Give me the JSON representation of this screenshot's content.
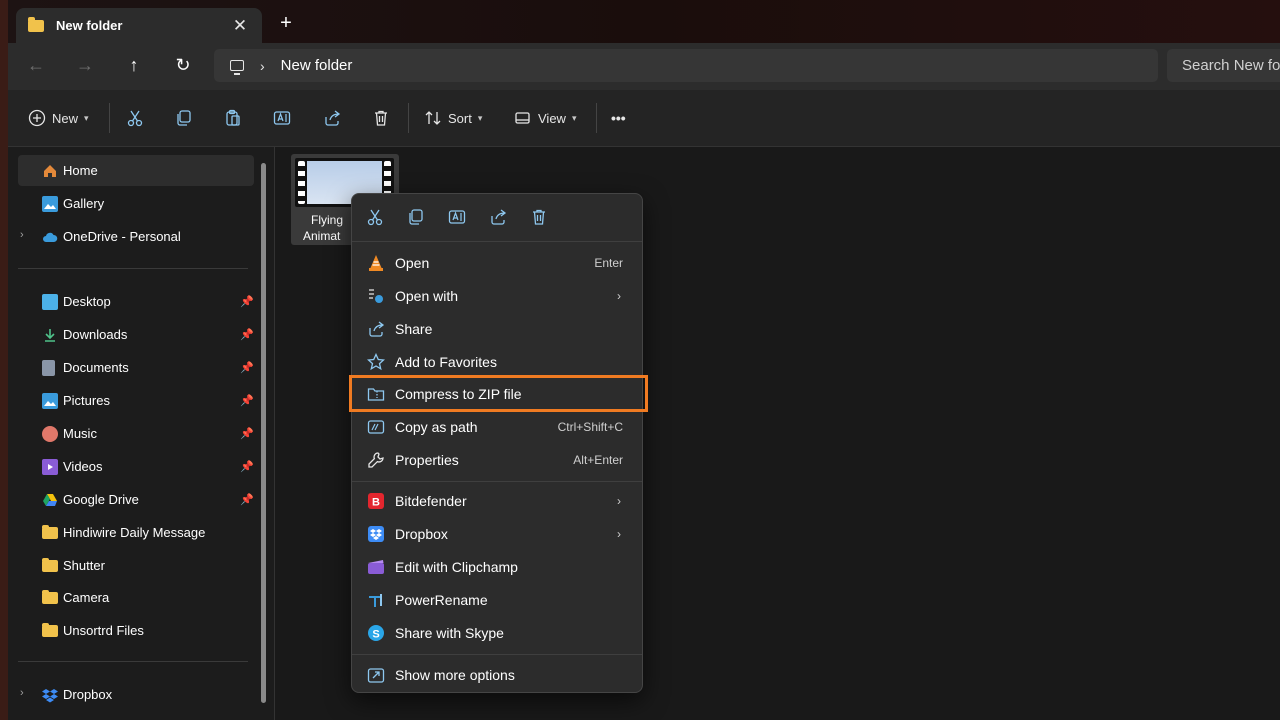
{
  "window": {
    "tab_title": "New folder",
    "tab_close": "✕",
    "new_tab": "+"
  },
  "nav": {
    "back": "←",
    "forward": "→",
    "up": "↑",
    "refresh": "↻",
    "breadcrumb_sep": "›",
    "breadcrumb": "New folder",
    "search_placeholder": "Search New folder"
  },
  "toolbar": {
    "new_label": "New",
    "sort_label": "Sort",
    "view_label": "View",
    "more_label": "•••"
  },
  "sidebar": {
    "home": "Home",
    "gallery": "Gallery",
    "onedrive": "OneDrive - Personal",
    "desktop": "Desktop",
    "downloads": "Downloads",
    "documents": "Documents",
    "pictures": "Pictures",
    "music": "Music",
    "videos": "Videos",
    "google_drive": "Google Drive",
    "hindiwire": "Hindiwire Daily Message",
    "shutter": "Shutter",
    "camera": "Camera",
    "unsortrd": "Unsortrd Files",
    "dropbox": "Dropbox"
  },
  "file": {
    "name_line1": "Flying",
    "name_line2": "Animat"
  },
  "context_menu": {
    "open": "Open",
    "open_shortcut": "Enter",
    "open_with": "Open with",
    "share": "Share",
    "add_favorites": "Add to Favorites",
    "compress": "Compress to ZIP file",
    "copy_path": "Copy as path",
    "copy_path_shortcut": "Ctrl+Shift+C",
    "properties": "Properties",
    "properties_shortcut": "Alt+Enter",
    "bitdefender": "Bitdefender",
    "dropbox": "Dropbox",
    "clipchamp": "Edit with Clipchamp",
    "powerrename": "PowerRename",
    "skype": "Share with Skype",
    "more_options": "Show more options",
    "submenu_arrow": "›"
  },
  "colors": {
    "highlight": "#f07b22",
    "folder": "#f1c24b",
    "accent_blue": "#3a9bdc"
  }
}
